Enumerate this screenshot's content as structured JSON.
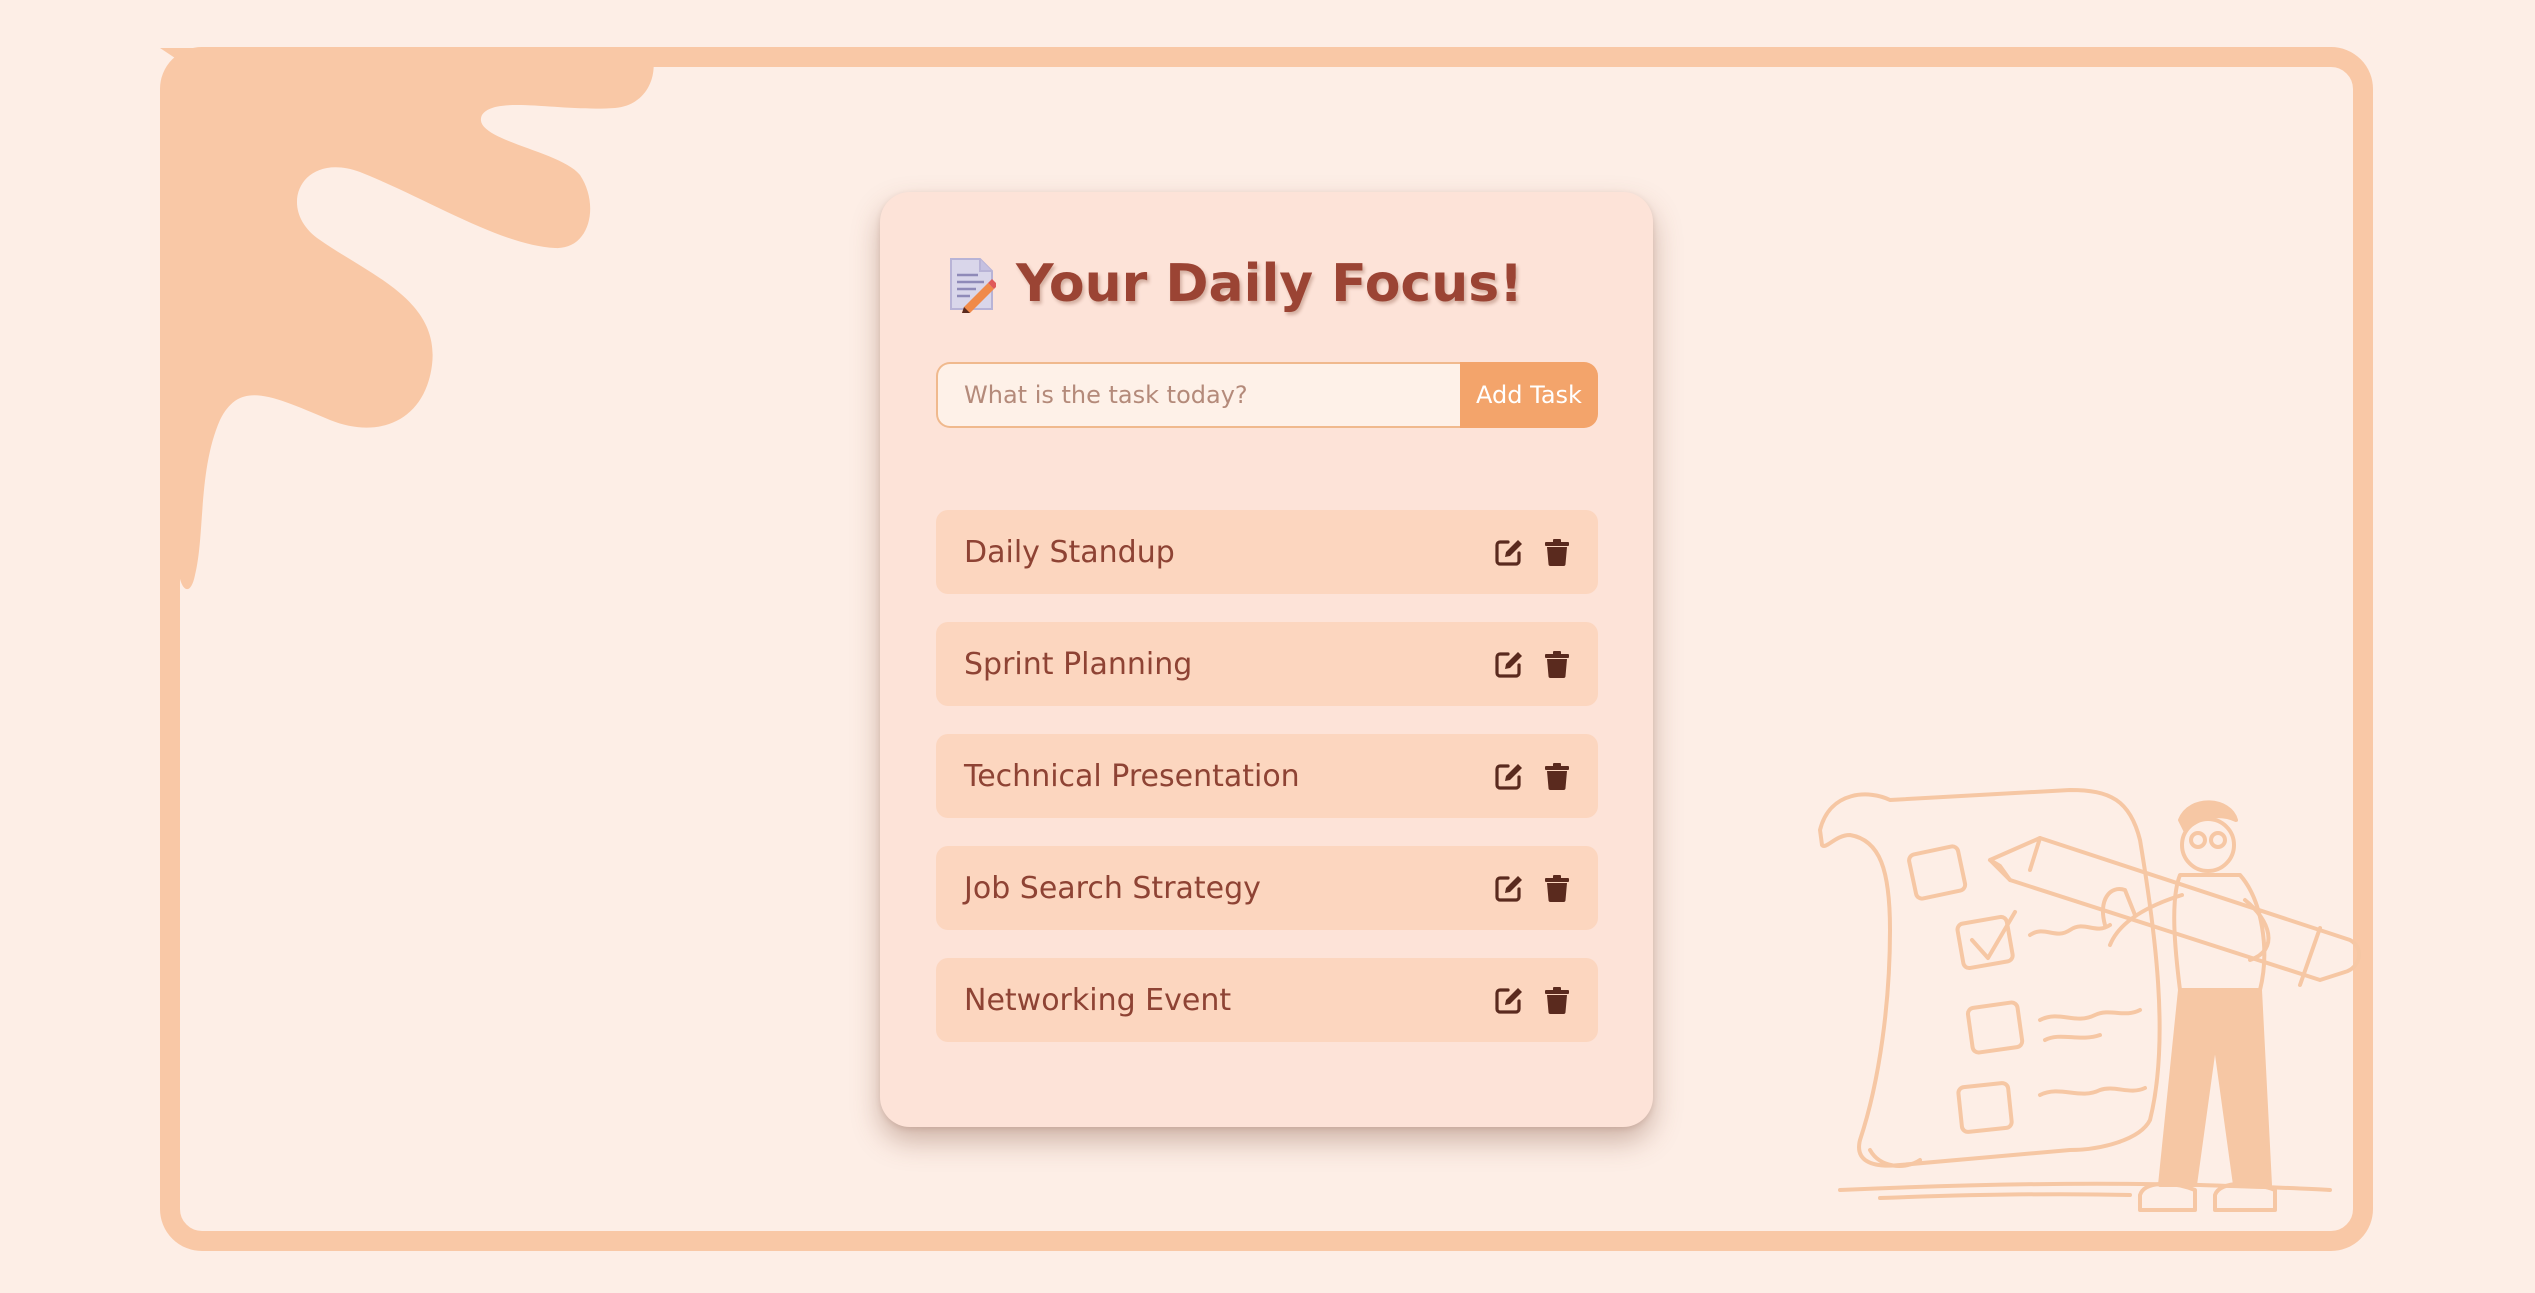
{
  "header": {
    "icon": "memo-icon",
    "title": "Your Daily Focus!"
  },
  "task_form": {
    "input_value": "",
    "input_placeholder": "What is the task today?",
    "add_button_label": "Add Task"
  },
  "tasks": [
    {
      "label": "Daily Standup"
    },
    {
      "label": "Sprint Planning"
    },
    {
      "label": "Technical Presentation"
    },
    {
      "label": "Job Search Strategy"
    },
    {
      "label": "Networking Event"
    }
  ],
  "task_actions": [
    "edit-icon",
    "delete-icon"
  ],
  "colors": {
    "page_background": "#fdeee6",
    "frame": "#f9c8a6",
    "card": "#fde3d8",
    "task_row": "#fcd6bf",
    "accent": "#f3a46b",
    "title_text": "#9b4434",
    "task_text": "#8e4334",
    "icon": "#5a2a1e"
  }
}
